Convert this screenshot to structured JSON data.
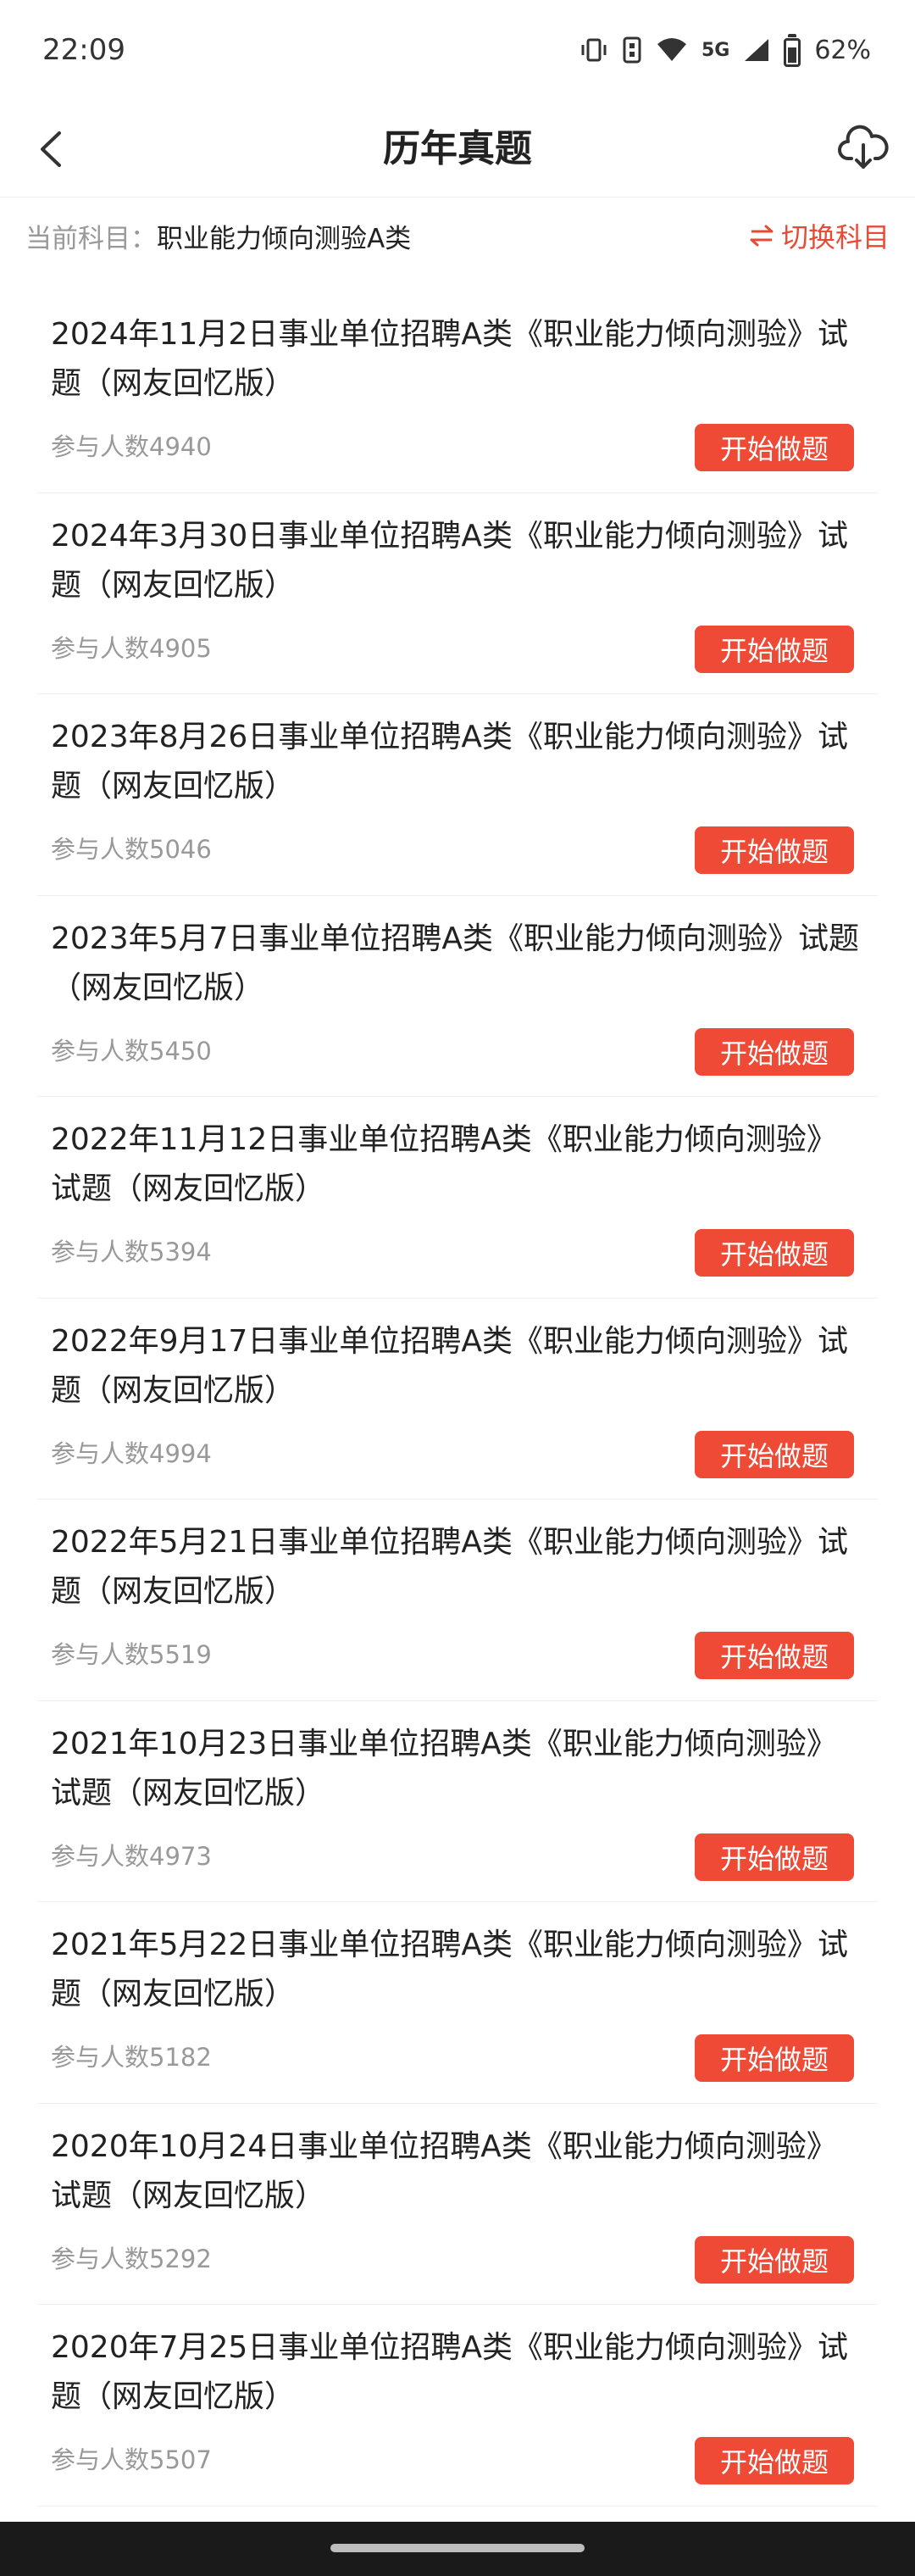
{
  "status": {
    "time": "22:09",
    "network": "5G",
    "battery": "62%"
  },
  "nav": {
    "title": "历年真题",
    "icons": [
      "back-icon",
      "download-icon"
    ]
  },
  "subject": {
    "label": "当前科目：",
    "value": "职业能力倾向测验A类",
    "switch_label": "切换科目",
    "switch_icon": "swap-icon"
  },
  "button_label": "开始做题",
  "accent_color": "#ee4a35",
  "items": [
    {
      "title": "2024年11月2日事业单位招聘A类《职业能力倾向测验》试题（网友回忆版）",
      "count": "参与人数4940"
    },
    {
      "title": "2024年3月30日事业单位招聘A类《职业能力倾向测验》试题（网友回忆版）",
      "count": "参与人数4905"
    },
    {
      "title": "2023年8月26日事业单位招聘A类《职业能力倾向测验》试题（网友回忆版）",
      "count": "参与人数5046"
    },
    {
      "title": "2023年5月7日事业单位招聘A类《职业能力倾向测验》试题（网友回忆版）",
      "count": "参与人数5450"
    },
    {
      "title": "2022年11月12日事业单位招聘A类《职业能力倾向测验》试题（网友回忆版）",
      "count": "参与人数5394"
    },
    {
      "title": "2022年9月17日事业单位招聘A类《职业能力倾向测验》试题（网友回忆版）",
      "count": "参与人数4994"
    },
    {
      "title": "2022年5月21日事业单位招聘A类《职业能力倾向测验》试题（网友回忆版）",
      "count": "参与人数5519"
    },
    {
      "title": "2021年10月23日事业单位招聘A类《职业能力倾向测验》试题（网友回忆版）",
      "count": "参与人数4973"
    },
    {
      "title": "2021年5月22日事业单位招聘A类《职业能力倾向测验》试题（网友回忆版）",
      "count": "参与人数5182"
    },
    {
      "title": "2020年10月24日事业单位招聘A类《职业能力倾向测验》试题（网友回忆版）",
      "count": "参与人数5292"
    },
    {
      "title": "2020年7月25日事业单位招聘A类《职业能力倾向测验》试题（网友回忆版）",
      "count": "参与人数5507"
    }
  ]
}
